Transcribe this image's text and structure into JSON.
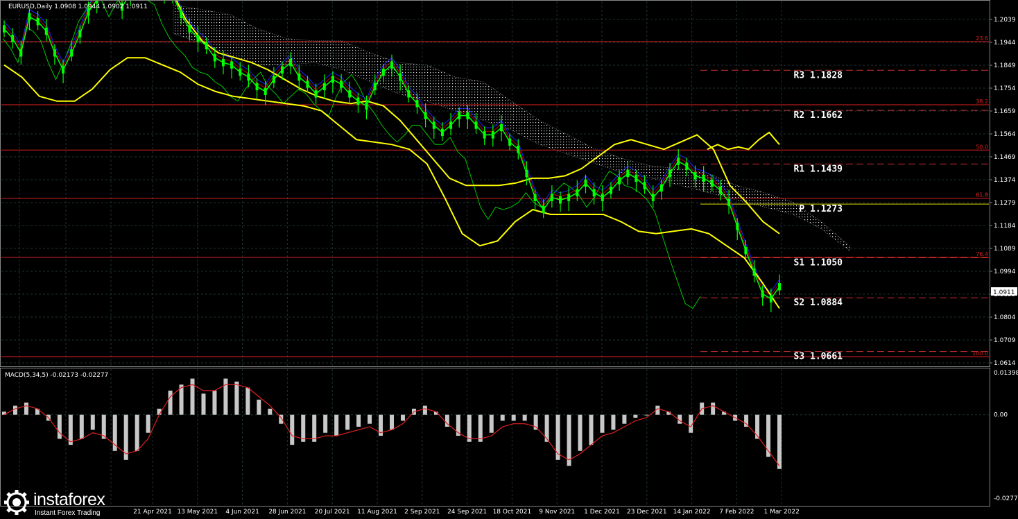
{
  "header": {
    "symbol_line": "EURUSD,Daily  1.0908 1.0944 1.0902 1.0911",
    "macd_label": "MACD(5,34,5) -0.02173 -0.02277"
  },
  "brand": {
    "name": "instaforex",
    "tagline": "Instant Forex Trading",
    "icon": "gear-globe-icon"
  },
  "colors": {
    "background": "#000000",
    "grid": "#1e3232",
    "candles": "#00ff00",
    "bands": "#ffff00",
    "fib": "#e02020",
    "pivot_dash": "#d03030",
    "ma_blue": "#2020ff",
    "ma_red": "#c00000",
    "chikou": "#00c800",
    "macd_hist": "#c8c8c8",
    "macd_signal": "#e02020"
  },
  "chart_data": [
    {
      "type": "line",
      "title": "EURUSD,Daily",
      "ylim": [
        1.0614,
        1.2086
      ],
      "y_ticks": [
        "1.2039",
        "1.1944",
        "1.1849",
        "1.1754",
        "1.1659",
        "1.1564",
        "1.1469",
        "1.1374",
        "1.1279",
        "1.1184",
        "1.1089",
        "1.0994",
        "1.0899",
        "1.0804",
        "1.0709",
        "1.0614"
      ],
      "x_ticks": [
        "21 Apr 2021",
        "13 May 2021",
        "4 Jun 2021",
        "28 Jun 2021",
        "20 Jul 2021",
        "11 Aug 2021",
        "2 Sep 2021",
        "24 Sep 2021",
        "18 Oct 2021",
        "9 Nov 2021",
        "1 Dec 2021",
        "23 Dec 2021",
        "14 Jan 2022",
        "7 Feb 2022",
        "1 Mar 2022"
      ],
      "current_price": "1.0911",
      "fib_levels": [
        {
          "label": "23.6",
          "value": 1.1947
        },
        {
          "label": "38.2",
          "value": 1.1685
        },
        {
          "label": "50.0",
          "value": 1.1497
        },
        {
          "label": "61.8",
          "value": 1.1297
        },
        {
          "label": "76.4",
          "value": 1.1052
        },
        {
          "label": "100.0",
          "value": 1.064
        }
      ],
      "pivot_levels": [
        {
          "label": "R3",
          "value_text": "1.1828",
          "value": 1.1828
        },
        {
          "label": "R2",
          "value_text": "1.1662",
          "value": 1.1662
        },
        {
          "label": "R1",
          "value_text": "1.1439",
          "value": 1.1439
        },
        {
          "label": "P",
          "value_text": "1.1273",
          "value": 1.1273
        },
        {
          "label": "S1",
          "value_text": "1.1050",
          "value": 1.105
        },
        {
          "label": "S2",
          "value_text": "1.0884",
          "value": 1.0884
        },
        {
          "label": "S3",
          "value_text": "1.0661",
          "value": 1.0661
        }
      ],
      "series": [
        {
          "kind": "price",
          "values": [
            1.2,
            1.196,
            1.19,
            1.205,
            1.203,
            1.199,
            1.19,
            1.183,
            1.19,
            1.198,
            1.207,
            1.212,
            1.217,
            1.216,
            1.209,
            1.215,
            1.218,
            1.22,
            1.219,
            1.216,
            1.214,
            1.206,
            1.2,
            1.196,
            1.193,
            1.188,
            1.186,
            1.185,
            1.182,
            1.18,
            1.176,
            1.174,
            1.179,
            1.183,
            1.186,
            1.18,
            1.177,
            1.173,
            1.176,
            1.179,
            1.177,
            1.173,
            1.17,
            1.168,
            1.176,
            1.182,
            1.185,
            1.18,
            1.173,
            1.169,
            1.164,
            1.16,
            1.157,
            1.16,
            1.164,
            1.164,
            1.16,
            1.156,
            1.156,
            1.159,
            1.153,
            1.15,
            1.14,
            1.13,
            1.125,
            1.13,
            1.129,
            1.13,
            1.132,
            1.136,
            1.132,
            1.13,
            1.133,
            1.137,
            1.14,
            1.138,
            1.135,
            1.13,
            1.134,
            1.14,
            1.145,
            1.143,
            1.139,
            1.138,
            1.136,
            1.133,
            1.128,
            1.118,
            1.108,
            1.099,
            1.09,
            1.088,
            1.093
          ]
        },
        {
          "kind": "band_upper",
          "values": [
            1.22,
            1.215,
            1.214,
            1.219,
            1.225,
            1.23,
            1.231,
            1.228,
            1.228,
            1.223,
            1.218,
            1.204,
            1.195,
            1.19,
            1.188,
            1.186,
            1.183,
            1.179,
            1.175,
            1.172,
            1.17,
            1.169,
            1.17,
            1.168,
            1.162,
            1.154,
            1.146,
            1.138,
            1.135,
            1.135,
            1.135,
            1.136,
            1.138,
            1.138,
            1.139,
            1.142,
            1.147,
            1.152,
            1.154,
            1.152,
            1.15,
            1.153,
            1.156,
            1.15,
            1.135,
            1.128,
            1.12,
            1.115
          ]
        },
        {
          "kind": "band_lower",
          "values": [
            1.185,
            1.18,
            1.172,
            1.17,
            1.17,
            1.175,
            1.183,
            1.188,
            1.188,
            1.185,
            1.182,
            1.177,
            1.174,
            1.172,
            1.171,
            1.17,
            1.169,
            1.168,
            1.166,
            1.16,
            1.154,
            1.153,
            1.152,
            1.15,
            1.144,
            1.13,
            1.115,
            1.11,
            1.112,
            1.12,
            1.125,
            1.123,
            1.123,
            1.123,
            1.123,
            1.12,
            1.116,
            1.115,
            1.116,
            1.117,
            1.115,
            1.11,
            1.105,
            1.095,
            1.084
          ]
        },
        {
          "kind": "kumo_upper",
          "values": [
            1.21,
            1.208,
            1.206,
            1.2,
            1.196,
            1.195,
            1.195,
            1.19,
            1.186,
            1.185,
            1.18,
            1.178,
            1.17,
            1.162,
            1.156,
            1.15,
            1.146,
            1.143,
            1.142,
            1.14,
            1.135,
            1.132,
            1.128,
            1.12,
            1.11
          ]
        },
        {
          "kind": "kumo_lower",
          "values": [
            1.198,
            1.194,
            1.189,
            1.185,
            1.185,
            1.186,
            1.183,
            1.178,
            1.173,
            1.17,
            1.166,
            1.162,
            1.158,
            1.152,
            1.148,
            1.144,
            1.14,
            1.138,
            1.135,
            1.132,
            1.129,
            1.126,
            1.123,
            1.117,
            1.108
          ]
        }
      ]
    },
    {
      "type": "bar",
      "title": "MACD(5,34,5)",
      "ylim": [
        -0.02771,
        0.01398
      ],
      "y_ticks": [
        "0.01398",
        "0.00",
        "-0.02771"
      ],
      "histogram": [
        0.001,
        0.003,
        0.004,
        0.002,
        -0.002,
        -0.008,
        -0.01,
        -0.008,
        -0.005,
        -0.008,
        -0.012,
        -0.015,
        -0.012,
        -0.006,
        0.002,
        0.008,
        0.01,
        0.012,
        0.007,
        0.008,
        0.012,
        0.011,
        0.009,
        0.005,
        0.002,
        -0.003,
        -0.01,
        -0.009,
        -0.009,
        -0.006,
        -0.007,
        -0.005,
        -0.004,
        -0.003,
        -0.007,
        -0.005,
        -0.002,
        0.002,
        0.003,
        0.001,
        -0.004,
        -0.007,
        -0.009,
        -0.009,
        -0.006,
        -0.002,
        -0.002,
        -0.002,
        -0.005,
        -0.009,
        -0.015,
        -0.017,
        -0.012,
        -0.01,
        -0.006,
        -0.005,
        -0.003,
        -0.001,
        0.0,
        0.003,
        0.001,
        -0.003,
        -0.006,
        0.004,
        0.004,
        0.001,
        -0.002,
        -0.004,
        -0.008,
        -0.014,
        -0.018
      ],
      "signal": [
        0.0,
        0.002,
        0.003,
        0.002,
        -0.001,
        -0.006,
        -0.009,
        -0.008,
        -0.006,
        -0.007,
        -0.01,
        -0.013,
        -0.012,
        -0.008,
        0.0,
        0.006,
        0.009,
        0.01,
        0.008,
        0.008,
        0.01,
        0.01,
        0.009,
        0.006,
        0.003,
        -0.001,
        -0.007,
        -0.008,
        -0.008,
        -0.007,
        -0.007,
        -0.006,
        -0.005,
        -0.004,
        -0.006,
        -0.005,
        -0.003,
        0.001,
        0.002,
        0.001,
        -0.003,
        -0.006,
        -0.008,
        -0.008,
        -0.007,
        -0.004,
        -0.003,
        -0.003,
        -0.004,
        -0.008,
        -0.013,
        -0.015,
        -0.013,
        -0.01,
        -0.007,
        -0.006,
        -0.004,
        -0.002,
        -0.001,
        0.002,
        0.001,
        -0.002,
        -0.004,
        0.002,
        0.003,
        0.001,
        -0.001,
        -0.003,
        -0.007,
        -0.012,
        -0.017
      ]
    }
  ]
}
